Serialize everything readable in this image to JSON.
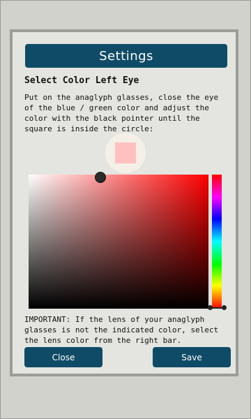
{
  "dialog": {
    "title": "Settings",
    "section_heading": "Select Color Left Eye",
    "instructions": "Put on the anaglyph glasses, close the eye of the blue / green color and adjust the color with the black pointer until the square is inside the circle:",
    "important_note": "IMPORTANT: If the lens of your anaglyph glasses is not the indicated color, select the lens color from the right bar.",
    "close_label": "Close",
    "save_label": "Save"
  },
  "colors": {
    "accent": "#0f4a66",
    "preview_color": "#ffc0c0",
    "selected_hue": "#ff0000",
    "preview_circle_bg": "#f4efe7"
  },
  "picker": {
    "saturation": 0.3,
    "value": 1.0,
    "hue_degrees": 0
  }
}
